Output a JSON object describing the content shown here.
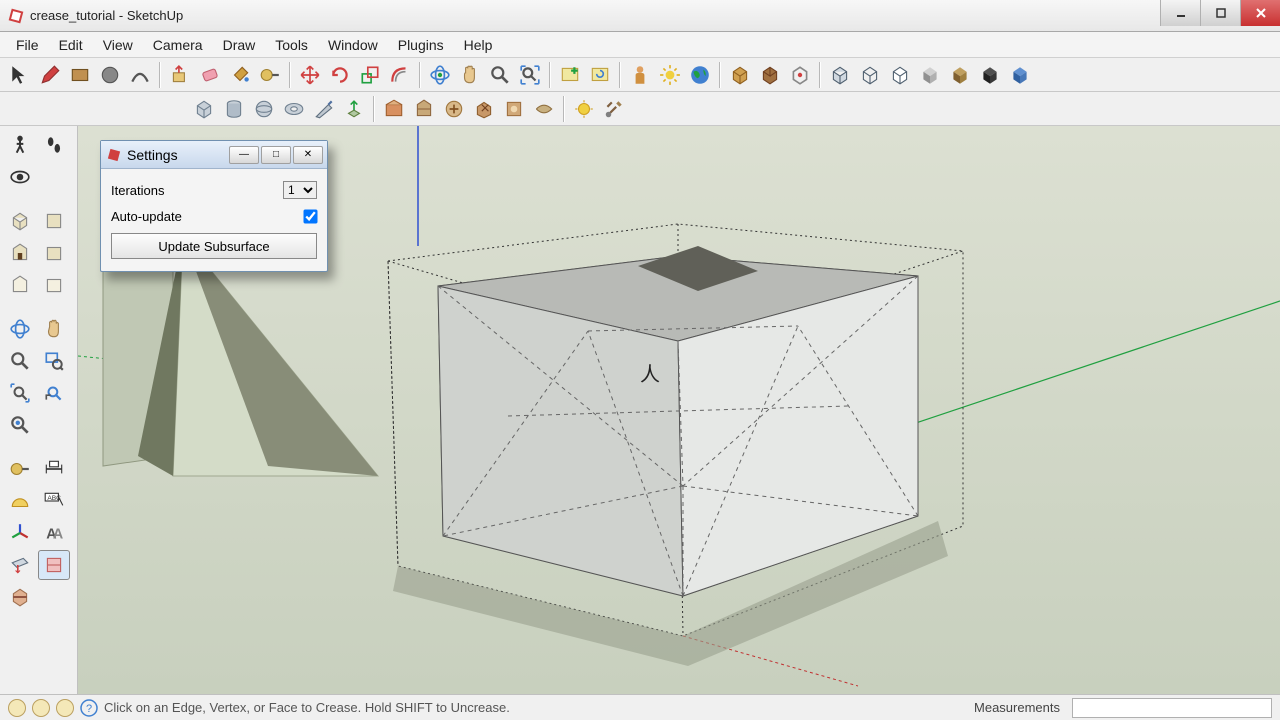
{
  "window": {
    "title": "crease_tutorial - SketchUp"
  },
  "menu": {
    "items": [
      "File",
      "Edit",
      "View",
      "Camera",
      "Draw",
      "Tools",
      "Window",
      "Plugins",
      "Help"
    ]
  },
  "toolbar_top": {
    "icons": [
      "select",
      "pencil",
      "rectangle",
      "circle",
      "arc",
      "push-pull",
      "eraser",
      "paint-bucket",
      "tape",
      "move",
      "rotate",
      "scale",
      "offset",
      "orbit",
      "pan",
      "zoom",
      "zoom-extents",
      "camera-prev",
      "camera-next",
      "person",
      "sun",
      "earth",
      "group",
      "component",
      "explode",
      "xray",
      "wireframe",
      "hidden",
      "shaded",
      "monochrome",
      "textured",
      "color-by-layer"
    ]
  },
  "toolbar_second": {
    "icons": [
      "box",
      "cylinder",
      "sphere",
      "torus",
      "cone",
      "prism",
      "plugin-a",
      "plugin-b",
      "plugin-c",
      "plugin-d",
      "plugin-e",
      "plugin-f",
      "plugin-g",
      "sun-tool",
      "tools-config"
    ]
  },
  "sidebar": {
    "rows": [
      [
        "walk-icon",
        "footsteps-icon"
      ],
      [
        "look-icon",
        ""
      ],
      [
        "iso-icon",
        "top-icon"
      ],
      [
        "front-icon",
        "right-icon"
      ],
      [
        "back-icon",
        "left-icon"
      ],
      [
        "orbit-icon",
        "pan-hand-icon"
      ],
      [
        "zoom-icon",
        "zoom-window-icon"
      ],
      [
        "zoom-extents-icon",
        "zoom-prev-icon"
      ],
      [
        "zoom-sel-icon",
        ""
      ],
      [
        "tape-icon",
        "dimension-icon"
      ],
      [
        "protractor-icon",
        "text-icon"
      ],
      [
        "axes-icon",
        "3dtext-icon"
      ],
      [
        "section-icon",
        "section-display-icon"
      ],
      [
        "section-fill-icon",
        ""
      ]
    ]
  },
  "settings_dialog": {
    "title": "Settings",
    "iterations_label": "Iterations",
    "iterations_value": "1",
    "autoupdate_label": "Auto-update",
    "autoupdate_checked": true,
    "button_label": "Update Subsurface"
  },
  "statusbar": {
    "hint": "Click on an Edge, Vertex, or Face to Crease.  Hold SHIFT to Uncrease.",
    "measurements_label": "Measurements"
  },
  "colors": {
    "viewport_bg_top": "#dce0d2",
    "viewport_bg_bottom": "#c8d0be",
    "axis_blue": "#3050d0",
    "axis_green": "#20a040",
    "axis_red": "#c03030"
  }
}
